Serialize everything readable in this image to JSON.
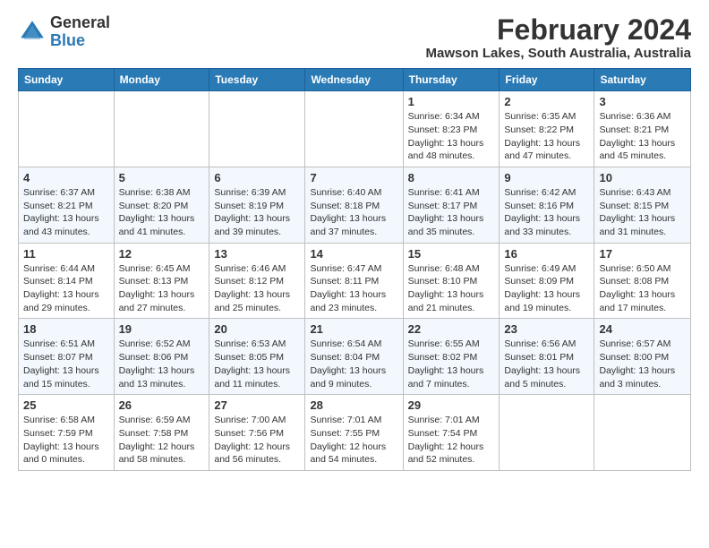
{
  "logo": {
    "general": "General",
    "blue": "Blue"
  },
  "title": {
    "month_year": "February 2024",
    "location": "Mawson Lakes, South Australia, Australia"
  },
  "days_header": [
    "Sunday",
    "Monday",
    "Tuesday",
    "Wednesday",
    "Thursday",
    "Friday",
    "Saturday"
  ],
  "weeks": [
    [
      {
        "day": "",
        "info": ""
      },
      {
        "day": "",
        "info": ""
      },
      {
        "day": "",
        "info": ""
      },
      {
        "day": "",
        "info": ""
      },
      {
        "day": "1",
        "info": "Sunrise: 6:34 AM\nSunset: 8:23 PM\nDaylight: 13 hours and 48 minutes."
      },
      {
        "day": "2",
        "info": "Sunrise: 6:35 AM\nSunset: 8:22 PM\nDaylight: 13 hours and 47 minutes."
      },
      {
        "day": "3",
        "info": "Sunrise: 6:36 AM\nSunset: 8:21 PM\nDaylight: 13 hours and 45 minutes."
      }
    ],
    [
      {
        "day": "4",
        "info": "Sunrise: 6:37 AM\nSunset: 8:21 PM\nDaylight: 13 hours and 43 minutes."
      },
      {
        "day": "5",
        "info": "Sunrise: 6:38 AM\nSunset: 8:20 PM\nDaylight: 13 hours and 41 minutes."
      },
      {
        "day": "6",
        "info": "Sunrise: 6:39 AM\nSunset: 8:19 PM\nDaylight: 13 hours and 39 minutes."
      },
      {
        "day": "7",
        "info": "Sunrise: 6:40 AM\nSunset: 8:18 PM\nDaylight: 13 hours and 37 minutes."
      },
      {
        "day": "8",
        "info": "Sunrise: 6:41 AM\nSunset: 8:17 PM\nDaylight: 13 hours and 35 minutes."
      },
      {
        "day": "9",
        "info": "Sunrise: 6:42 AM\nSunset: 8:16 PM\nDaylight: 13 hours and 33 minutes."
      },
      {
        "day": "10",
        "info": "Sunrise: 6:43 AM\nSunset: 8:15 PM\nDaylight: 13 hours and 31 minutes."
      }
    ],
    [
      {
        "day": "11",
        "info": "Sunrise: 6:44 AM\nSunset: 8:14 PM\nDaylight: 13 hours and 29 minutes."
      },
      {
        "day": "12",
        "info": "Sunrise: 6:45 AM\nSunset: 8:13 PM\nDaylight: 13 hours and 27 minutes."
      },
      {
        "day": "13",
        "info": "Sunrise: 6:46 AM\nSunset: 8:12 PM\nDaylight: 13 hours and 25 minutes."
      },
      {
        "day": "14",
        "info": "Sunrise: 6:47 AM\nSunset: 8:11 PM\nDaylight: 13 hours and 23 minutes."
      },
      {
        "day": "15",
        "info": "Sunrise: 6:48 AM\nSunset: 8:10 PM\nDaylight: 13 hours and 21 minutes."
      },
      {
        "day": "16",
        "info": "Sunrise: 6:49 AM\nSunset: 8:09 PM\nDaylight: 13 hours and 19 minutes."
      },
      {
        "day": "17",
        "info": "Sunrise: 6:50 AM\nSunset: 8:08 PM\nDaylight: 13 hours and 17 minutes."
      }
    ],
    [
      {
        "day": "18",
        "info": "Sunrise: 6:51 AM\nSunset: 8:07 PM\nDaylight: 13 hours and 15 minutes."
      },
      {
        "day": "19",
        "info": "Sunrise: 6:52 AM\nSunset: 8:06 PM\nDaylight: 13 hours and 13 minutes."
      },
      {
        "day": "20",
        "info": "Sunrise: 6:53 AM\nSunset: 8:05 PM\nDaylight: 13 hours and 11 minutes."
      },
      {
        "day": "21",
        "info": "Sunrise: 6:54 AM\nSunset: 8:04 PM\nDaylight: 13 hours and 9 minutes."
      },
      {
        "day": "22",
        "info": "Sunrise: 6:55 AM\nSunset: 8:02 PM\nDaylight: 13 hours and 7 minutes."
      },
      {
        "day": "23",
        "info": "Sunrise: 6:56 AM\nSunset: 8:01 PM\nDaylight: 13 hours and 5 minutes."
      },
      {
        "day": "24",
        "info": "Sunrise: 6:57 AM\nSunset: 8:00 PM\nDaylight: 13 hours and 3 minutes."
      }
    ],
    [
      {
        "day": "25",
        "info": "Sunrise: 6:58 AM\nSunset: 7:59 PM\nDaylight: 13 hours and 0 minutes."
      },
      {
        "day": "26",
        "info": "Sunrise: 6:59 AM\nSunset: 7:58 PM\nDaylight: 12 hours and 58 minutes."
      },
      {
        "day": "27",
        "info": "Sunrise: 7:00 AM\nSunset: 7:56 PM\nDaylight: 12 hours and 56 minutes."
      },
      {
        "day": "28",
        "info": "Sunrise: 7:01 AM\nSunset: 7:55 PM\nDaylight: 12 hours and 54 minutes."
      },
      {
        "day": "29",
        "info": "Sunrise: 7:01 AM\nSunset: 7:54 PM\nDaylight: 12 hours and 52 minutes."
      },
      {
        "day": "",
        "info": ""
      },
      {
        "day": "",
        "info": ""
      }
    ]
  ]
}
